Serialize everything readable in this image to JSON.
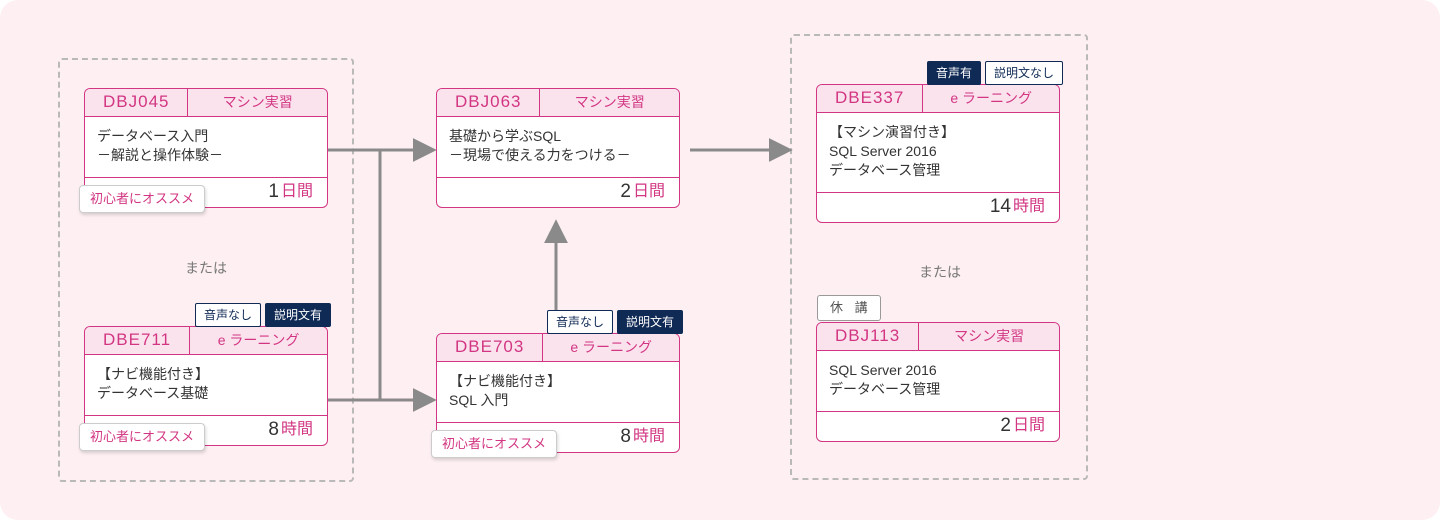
{
  "labels": {
    "or": "または",
    "beginner": "初心者にオススメ",
    "suspended": "休 講"
  },
  "tags": {
    "machine": "マシン実習",
    "elearning": "e ラーニング"
  },
  "units": {
    "days": "日間",
    "hours": "時間"
  },
  "flags": {
    "audio_yes": "音声有",
    "audio_no": "音声なし",
    "text_yes": "説明文有",
    "text_no": "説明文なし"
  },
  "courses": {
    "dbj045": {
      "code": "DBJ045",
      "tag_key": "machine",
      "title": "データベース入門\n－解説と操作体験－",
      "duration_num": "1",
      "duration_unit_key": "days",
      "beginner": true
    },
    "dbe711": {
      "code": "DBE711",
      "tag_key": "elearning",
      "title": "【ナビ機能付き】\nデータベース基礎",
      "duration_num": "8",
      "duration_unit_key": "hours",
      "beginner": true,
      "flag_audio_key": "audio_no",
      "flag_text_key": "text_yes"
    },
    "dbj063": {
      "code": "DBJ063",
      "tag_key": "machine",
      "title": "基礎から学ぶSQL\n－現場で使える力をつける－",
      "duration_num": "2",
      "duration_unit_key": "days"
    },
    "dbe703": {
      "code": "DBE703",
      "tag_key": "elearning",
      "title": "【ナビ機能付き】\nSQL 入門",
      "duration_num": "8",
      "duration_unit_key": "hours",
      "beginner": true,
      "flag_audio_key": "audio_no",
      "flag_text_key": "text_yes"
    },
    "dbe337": {
      "code": "DBE337",
      "tag_key": "elearning",
      "title": "【マシン演習付き】\nSQL Server 2016\nデータベース管理",
      "duration_num": "14",
      "duration_unit_key": "hours",
      "flag_audio_key": "audio_yes",
      "flag_text_key": "text_no"
    },
    "dbj113": {
      "code": "DBJ113",
      "tag_key": "machine",
      "title": "SQL Server 2016\nデータベース管理",
      "duration_num": "2",
      "duration_unit_key": "days",
      "suspended": true
    }
  }
}
